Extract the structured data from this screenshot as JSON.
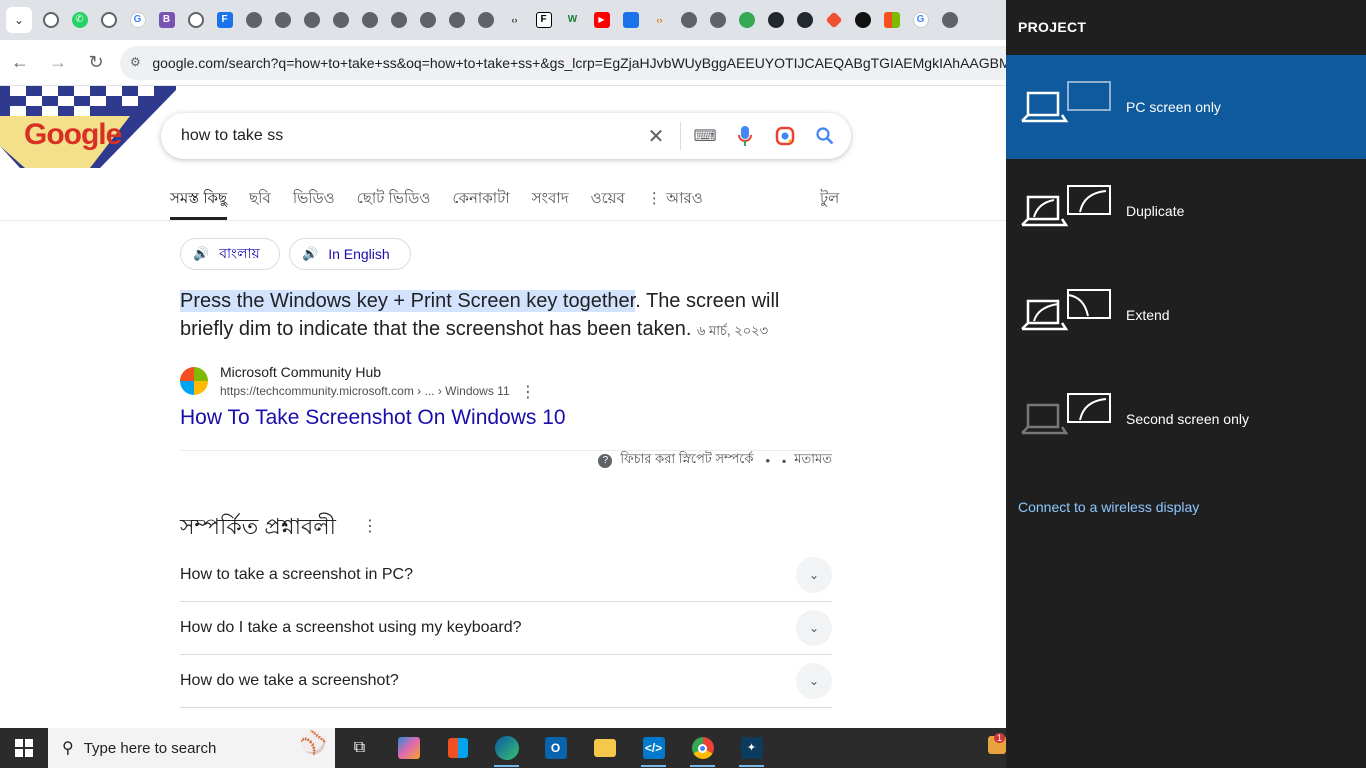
{
  "browser": {
    "url": "google.com/search?q=how+to+take+ss&oq=how+to+take+ss+&gs_lcrp=EgZjaHJvbWUyBggAEEUYOTIJCAEQABgTGIAEMgkIAhAAGBMY",
    "tab_icons": [
      "chrome-icon",
      "whatsapp-icon",
      "chrome-icon",
      "google-icon",
      "bootstrap-icon",
      "chatgpt-icon",
      "forms-icon",
      "globe-icon",
      "globe-icon",
      "globe-icon",
      "globe-icon",
      "globe-icon",
      "globe-icon",
      "globe-icon",
      "globe-icon",
      "globe-icon",
      "code-icon",
      "formatter-icon",
      "wordwall-icon",
      "youtube-icon",
      "flag-icon",
      "code-icon",
      "globe-icon",
      "globe-icon",
      "maps-icon",
      "github-icon",
      "github-icon",
      "git-icon",
      "dot-icon",
      "microsoft-icon",
      "google-icon",
      "globe-icon"
    ]
  },
  "google": {
    "query": "how to take ss",
    "logo": "Google",
    "tabs": [
      "সমস্ত কিছু",
      "ছবি",
      "ভিডিও",
      "ছোট ভিডিও",
      "কেনাকাটা",
      "সংবাদ",
      "ওয়েব",
      "⋮ আরও"
    ],
    "tools": "টুল",
    "lang_bangla": "বাংলায়",
    "lang_english": "In English",
    "snippet_highlight": "Press the Windows key + Print Screen key together",
    "snippet_rest": ". The screen will briefly dim to indicate that the screenshot has been taken.",
    "snippet_date": "৬ মার্চ, ২০২৩",
    "source_name": "Microsoft Community Hub",
    "source_url": "https://techcommunity.microsoft.com › ... › Windows 11",
    "result_title": "How To Take Screenshot On Windows 10",
    "featured_about": "ফিচার করা স্নিপেট সম্পর্কে",
    "feedback": "মতামত",
    "paa_title": "সম্পর্কিত প্রশ্নাবলী",
    "paa": [
      "How to take a screenshot in PC?",
      "How do I take a screenshot using my keyboard?",
      "How do we take a screenshot?"
    ]
  },
  "taskbar": {
    "search_placeholder": "Type here to search",
    "apps": [
      "task-view-icon",
      "copilot-icon",
      "store-icon",
      "edge-icon",
      "outlook-icon",
      "explorer-icon",
      "vscode-icon",
      "chrome-icon",
      "mysql-icon"
    ],
    "notification_count": "1"
  },
  "project": {
    "title": "PROJECT",
    "options": [
      "PC screen only",
      "Duplicate",
      "Extend",
      "Second screen only"
    ],
    "selected": "PC screen only",
    "wireless_link": "Connect to a wireless display"
  }
}
